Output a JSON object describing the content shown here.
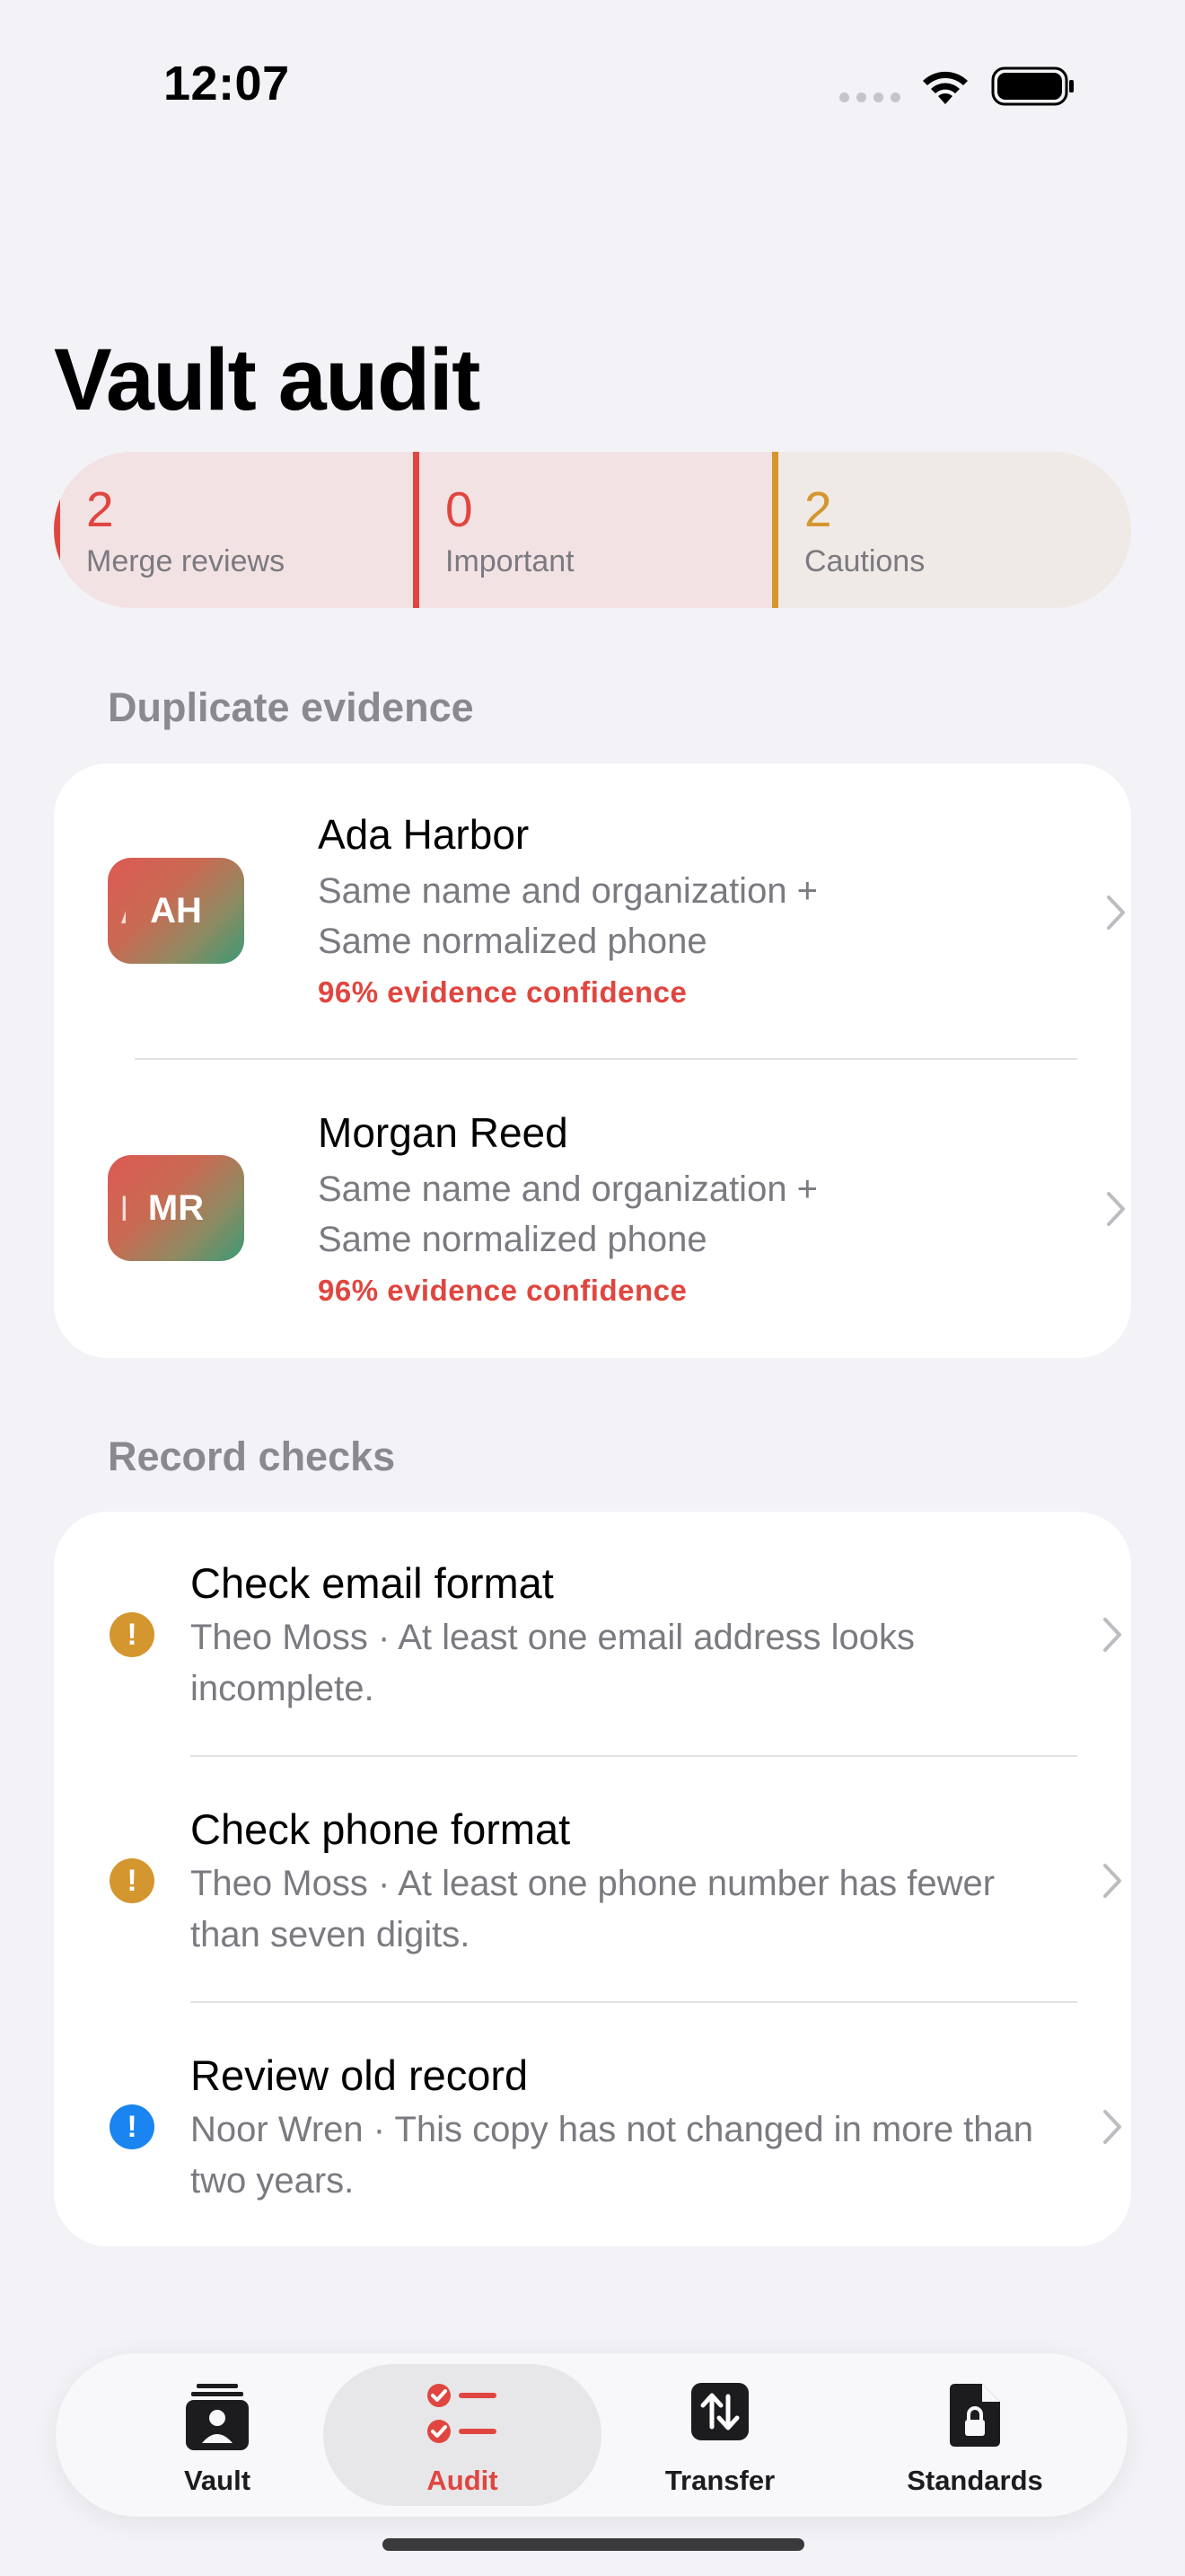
{
  "status": {
    "time": "12:07"
  },
  "title": "Vault audit",
  "summary": [
    {
      "value": "2",
      "label": "Merge reviews",
      "color": "#e0463f"
    },
    {
      "value": "0",
      "label": "Important",
      "color": "#e0463f"
    },
    {
      "value": "2",
      "label": "Cautions",
      "color": "#d4962e"
    }
  ],
  "duplicate": {
    "section_label": "Duplicate evidence",
    "items": [
      {
        "initials": "AH",
        "name": "Ada Harbor",
        "line1": "Same name and organization +",
        "line2": "Same normalized phone",
        "confidence": "96% evidence confidence"
      },
      {
        "initials": "MR",
        "name": "Morgan Reed",
        "line1": "Same name and organization +",
        "line2": "Same normalized phone",
        "confidence": "96% evidence confidence"
      }
    ]
  },
  "checks": {
    "section_label": "Record checks",
    "items": [
      {
        "title": "Check email format",
        "desc": "Theo Moss · At least one email address looks incomplete.",
        "level": "caution",
        "color": "#d4962e"
      },
      {
        "title": "Check phone format",
        "desc": "Theo Moss · At least one phone number has fewer than seven digits.",
        "level": "caution",
        "color": "#d4962e"
      },
      {
        "title": "Review old record",
        "desc": "Noor Wren · This copy has not changed in more than two years.",
        "level": "info",
        "color": "#1a84f0"
      }
    ]
  },
  "tabs": [
    {
      "label": "Vault",
      "icon": "vault-icon"
    },
    {
      "label": "Audit",
      "icon": "checklist-icon",
      "active": true
    },
    {
      "label": "Transfer",
      "icon": "transfer-icon"
    },
    {
      "label": "Standards",
      "icon": "locked-document-icon"
    }
  ],
  "colors": {
    "accent": "#e0463f",
    "caution": "#d4962e",
    "info": "#1a84f0"
  }
}
